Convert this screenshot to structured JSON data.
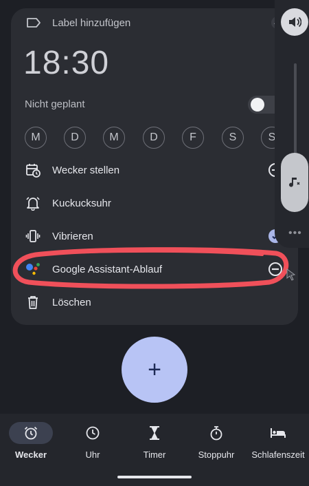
{
  "alarm": {
    "label_placeholder": "Label hinzufügen",
    "time": "18:30",
    "schedule_status": "Nicht geplant",
    "toggle_on": false,
    "days": [
      "M",
      "D",
      "M",
      "D",
      "F",
      "S",
      "S"
    ]
  },
  "options": [
    {
      "label": "Wecker stellen",
      "icon": "calendar-clock-icon",
      "action": "add"
    },
    {
      "label": "Kuckucksuhr",
      "icon": "alarm-bell-icon"
    },
    {
      "label": "Vibrieren",
      "icon": "vibrate-icon",
      "checked": true
    },
    {
      "label": "Google Assistant-Ablauf",
      "icon": "google-assistant-icon",
      "action": "remove"
    },
    {
      "label": "Löschen",
      "icon": "trash-icon"
    }
  ],
  "fab": {
    "symbol": "+"
  },
  "nav": [
    {
      "label": "Wecker",
      "icon": "alarm-icon",
      "active": true
    },
    {
      "label": "Uhr",
      "icon": "clock-icon"
    },
    {
      "label": "Timer",
      "icon": "hourglass-icon"
    },
    {
      "label": "Stoppuhr",
      "icon": "stopwatch-icon"
    },
    {
      "label": "Schlafenszeit",
      "icon": "bed-icon"
    }
  ],
  "colors": {
    "background": "#1d1f25",
    "card": "#2b2d33",
    "fab": "#b8c4f5",
    "highlight_annotation": "#f0505a",
    "check": "#aab6e8"
  }
}
